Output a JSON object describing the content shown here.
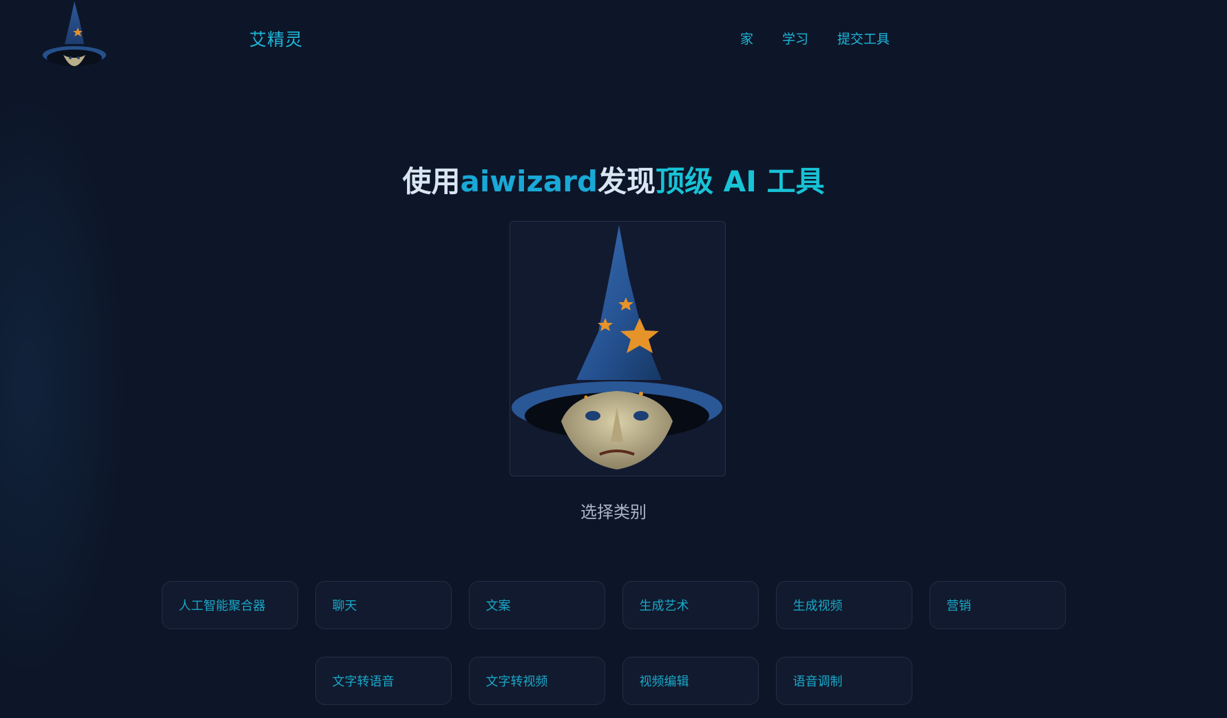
{
  "header": {
    "brand": "艾精灵",
    "nav": [
      "家",
      "学习",
      "提交工具"
    ]
  },
  "hero": {
    "headline_parts": [
      "使用",
      "aiwizard",
      "发现",
      "顶级 AI 工具"
    ],
    "subtitle": "选择类别"
  },
  "categories_row1": [
    "人工智能聚合器",
    "聊天",
    "文案",
    "生成艺术",
    "生成视频",
    "营销"
  ],
  "categories_row2": [
    "文字转语音",
    "文字转视频",
    "视频编辑",
    "语音调制"
  ],
  "colors": {
    "background": "#0d1629",
    "accent": "#1fb6d9",
    "card_border": "#242d45"
  }
}
